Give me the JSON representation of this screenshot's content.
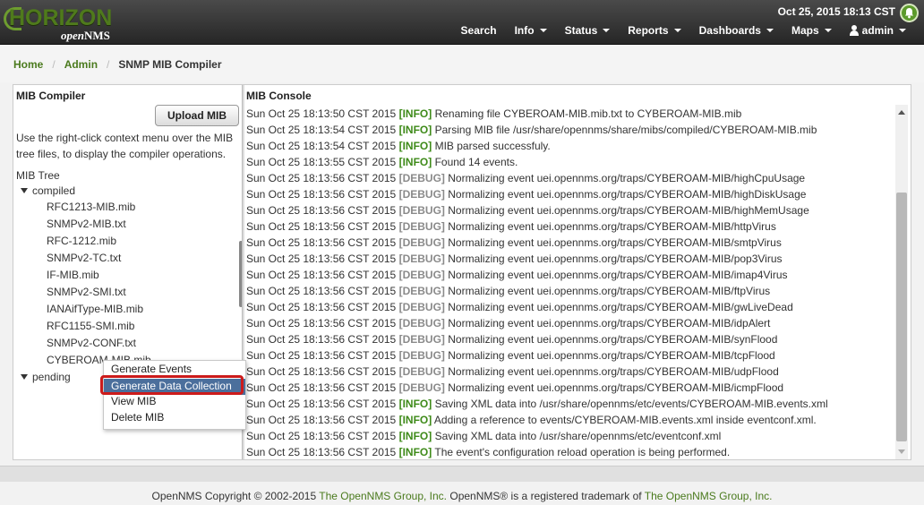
{
  "header": {
    "logo_main": "HORIZON",
    "logo_sub_open": "open",
    "logo_sub_nms": "NMS",
    "datetime": "Oct 25, 2015 18:13 CST",
    "nav": [
      {
        "label": "Search",
        "dropdown": false
      },
      {
        "label": "Info",
        "dropdown": true
      },
      {
        "label": "Status",
        "dropdown": true
      },
      {
        "label": "Reports",
        "dropdown": true
      },
      {
        "label": "Dashboards",
        "dropdown": true
      },
      {
        "label": "Maps",
        "dropdown": true
      },
      {
        "label": "admin",
        "dropdown": true,
        "icon": "user-icon"
      }
    ],
    "notification_icon": "bell-icon"
  },
  "breadcrumb": {
    "home": "Home",
    "admin": "Admin",
    "current": "SNMP MIB Compiler",
    "separator": "/"
  },
  "compiler": {
    "title": "MIB Compiler",
    "upload_label": "Upload MIB",
    "help": "Use the right-click context menu over the MIB tree files, to display the compiler operations.",
    "tree_label": "MIB Tree",
    "compiled_label": "compiled",
    "pending_label": "pending",
    "files": [
      "RFC1213-MIB.mib",
      "SNMPv2-MIB.txt",
      "RFC-1212.mib",
      "SNMPv2-TC.txt",
      "IF-MIB.mib",
      "SNMPv2-SMI.txt",
      "IANAifType-MIB.mib",
      "RFC1155-SMI.mib",
      "SNMPv2-CONF.txt",
      "CYBEROAM-MIB.mib"
    ]
  },
  "context_menu": {
    "items": [
      "Generate Events",
      "Generate Data Collection",
      "View MIB",
      "Delete MIB"
    ],
    "active_index": 1
  },
  "console": {
    "title": "MIB Console",
    "lines": [
      {
        "ts": "Sun Oct 25 18:13:50 CST 2015",
        "level": "[INFO]",
        "msg": "Renaming file CYBEROAM-MIB.mib.txt to CYBEROAM-MIB.mib"
      },
      {
        "ts": "Sun Oct 25 18:13:54 CST 2015",
        "level": "[INFO]",
        "msg": "Parsing MIB file /usr/share/opennms/share/mibs/compiled/CYBEROAM-MIB.mib"
      },
      {
        "ts": "Sun Oct 25 18:13:54 CST 2015",
        "level": "[INFO]",
        "msg": "MIB parsed successfuly."
      },
      {
        "ts": "Sun Oct 25 18:13:55 CST 2015",
        "level": "[INFO]",
        "msg": "Found 14 events."
      },
      {
        "ts": "Sun Oct 25 18:13:56 CST 2015",
        "level": "[DEBUG]",
        "msg": "Normalizing event uei.opennms.org/traps/CYBEROAM-MIB/highCpuUsage"
      },
      {
        "ts": "Sun Oct 25 18:13:56 CST 2015",
        "level": "[DEBUG]",
        "msg": "Normalizing event uei.opennms.org/traps/CYBEROAM-MIB/highDiskUsage"
      },
      {
        "ts": "Sun Oct 25 18:13:56 CST 2015",
        "level": "[DEBUG]",
        "msg": "Normalizing event uei.opennms.org/traps/CYBEROAM-MIB/highMemUsage"
      },
      {
        "ts": "Sun Oct 25 18:13:56 CST 2015",
        "level": "[DEBUG]",
        "msg": "Normalizing event uei.opennms.org/traps/CYBEROAM-MIB/httpVirus"
      },
      {
        "ts": "Sun Oct 25 18:13:56 CST 2015",
        "level": "[DEBUG]",
        "msg": "Normalizing event uei.opennms.org/traps/CYBEROAM-MIB/smtpVirus"
      },
      {
        "ts": "Sun Oct 25 18:13:56 CST 2015",
        "level": "[DEBUG]",
        "msg": "Normalizing event uei.opennms.org/traps/CYBEROAM-MIB/pop3Virus"
      },
      {
        "ts": "Sun Oct 25 18:13:56 CST 2015",
        "level": "[DEBUG]",
        "msg": "Normalizing event uei.opennms.org/traps/CYBEROAM-MIB/imap4Virus"
      },
      {
        "ts": "Sun Oct 25 18:13:56 CST 2015",
        "level": "[DEBUG]",
        "msg": "Normalizing event uei.opennms.org/traps/CYBEROAM-MIB/ftpVirus"
      },
      {
        "ts": "Sun Oct 25 18:13:56 CST 2015",
        "level": "[DEBUG]",
        "msg": "Normalizing event uei.opennms.org/traps/CYBEROAM-MIB/gwLiveDead"
      },
      {
        "ts": "Sun Oct 25 18:13:56 CST 2015",
        "level": "[DEBUG]",
        "msg": "Normalizing event uei.opennms.org/traps/CYBEROAM-MIB/idpAlert"
      },
      {
        "ts": "Sun Oct 25 18:13:56 CST 2015",
        "level": "[DEBUG]",
        "msg": "Normalizing event uei.opennms.org/traps/CYBEROAM-MIB/synFlood"
      },
      {
        "ts": "Sun Oct 25 18:13:56 CST 2015",
        "level": "[DEBUG]",
        "msg": "Normalizing event uei.opennms.org/traps/CYBEROAM-MIB/tcpFlood"
      },
      {
        "ts": "Sun Oct 25 18:13:56 CST 2015",
        "level": "[DEBUG]",
        "msg": "Normalizing event uei.opennms.org/traps/CYBEROAM-MIB/udpFlood"
      },
      {
        "ts": "Sun Oct 25 18:13:56 CST 2015",
        "level": "[DEBUG]",
        "msg": "Normalizing event uei.opennms.org/traps/CYBEROAM-MIB/icmpFlood"
      },
      {
        "ts": "Sun Oct 25 18:13:56 CST 2015",
        "level": "[INFO]",
        "msg": "Saving XML data into /usr/share/opennms/etc/events/CYBEROAM-MIB.events.xml"
      },
      {
        "ts": "Sun Oct 25 18:13:56 CST 2015",
        "level": "[INFO]",
        "msg": "Adding a reference to events/CYBEROAM-MIB.events.xml inside eventconf.xml."
      },
      {
        "ts": "Sun Oct 25 18:13:56 CST 2015",
        "level": "[INFO]",
        "msg": "Saving XML data into /usr/share/opennms/etc/eventconf.xml"
      },
      {
        "ts": "Sun Oct 25 18:13:56 CST 2015",
        "level": "[INFO]",
        "msg": "The event's configuration reload operation is being performed."
      }
    ]
  },
  "footer": {
    "prefix": "OpenNMS",
    "copyright": "Copyright © 2002-2015",
    "group1": "The OpenNMS Group, Inc.",
    "middle": "OpenNMS® is a registered trademark of",
    "group2": "The OpenNMS Group, Inc."
  },
  "colors": {
    "brand_green": "#4a7a1d",
    "info_green": "#3e8a19",
    "debug_gray": "#8a8a8a",
    "menu_highlight": "#4b6f9c",
    "annotation_red": "#cc1b1b"
  }
}
